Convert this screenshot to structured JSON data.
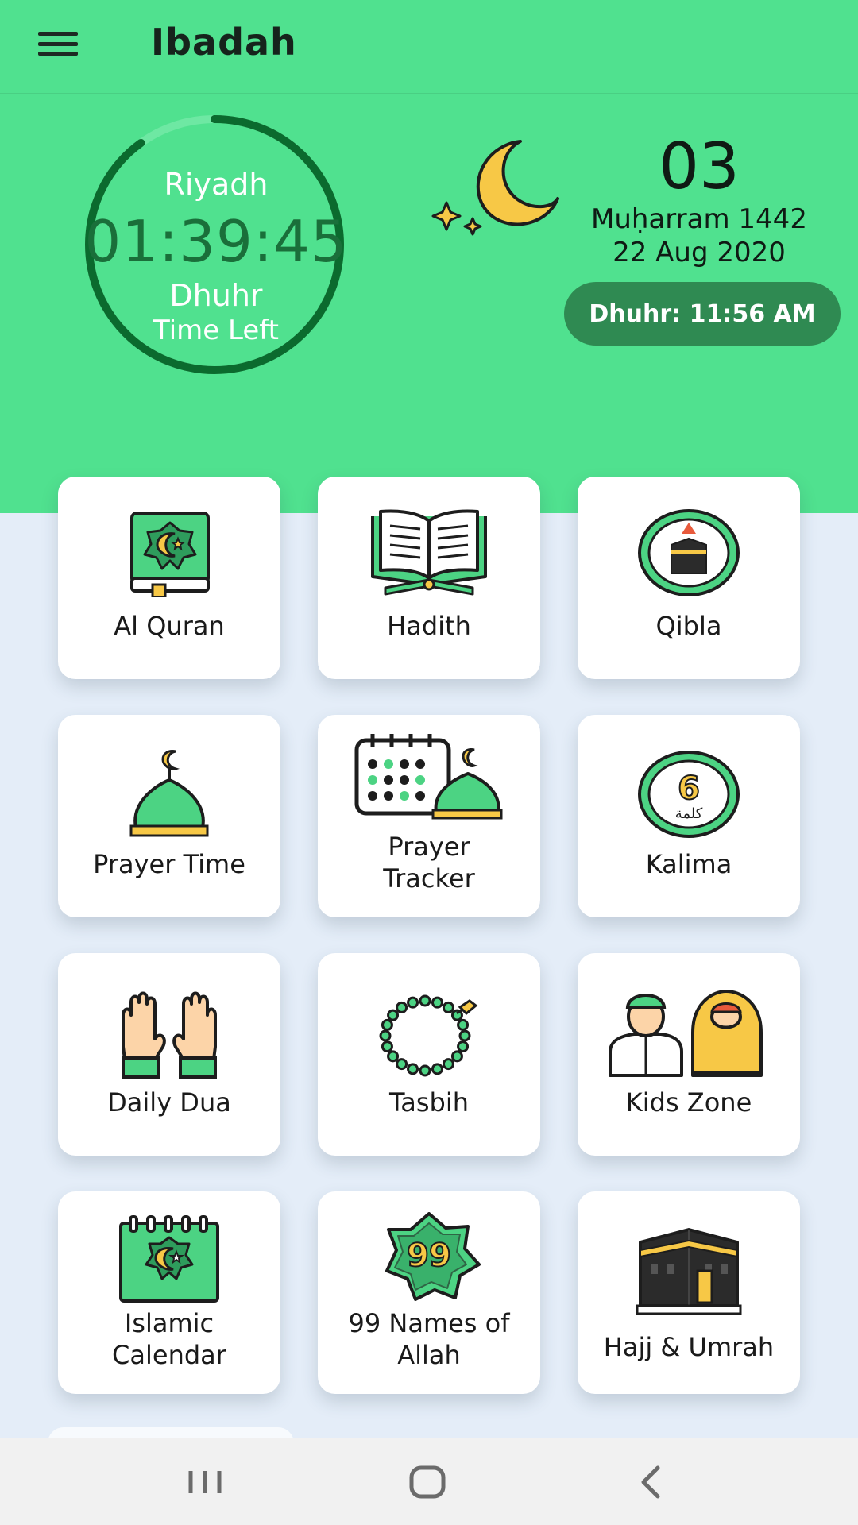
{
  "appbar": {
    "title": "Ibadah",
    "menu_icon": "hamburger-menu-icon"
  },
  "timer": {
    "city": "Riyadh",
    "time_left": "01:39:45",
    "prayer": "Dhuhr",
    "caption": "Time Left",
    "progress": 0.9
  },
  "date": {
    "day": "03",
    "hijri": "Muḥarram 1442",
    "gregorian": "22 Aug 2020"
  },
  "next_prayer": {
    "label": "Dhuhr: 11:56 AM"
  },
  "colors": {
    "header": "#50e18f",
    "accent_dark": "#0b6a2e",
    "pill": "#2f8a52",
    "background": "#e4edf8"
  },
  "tiles": [
    {
      "label": "Al Quran",
      "icon": "quran-book-icon"
    },
    {
      "label": "Hadith",
      "icon": "open-book-icon"
    },
    {
      "label": "Qibla",
      "icon": "qibla-compass-icon"
    },
    {
      "label": "Prayer Time",
      "icon": "mosque-dome-icon"
    },
    {
      "label": "Prayer Tracker",
      "icon": "calendar-mosque-icon"
    },
    {
      "label": "Kalima",
      "icon": "kalima-icon"
    },
    {
      "label": "Daily Dua",
      "icon": "praying-hands-icon"
    },
    {
      "label": "Tasbih",
      "icon": "prayer-beads-icon"
    },
    {
      "label": "Kids Zone",
      "icon": "kids-icon"
    },
    {
      "label": "Islamic Calendar",
      "icon": "islamic-calendar-icon"
    },
    {
      "label": "99 Names of Allah",
      "icon": "ninety-nine-names-icon"
    },
    {
      "label": "Hajj & Umrah",
      "icon": "kaaba-icon"
    }
  ],
  "kalima_badge": "6",
  "kalima_arabic": "كلمة",
  "names_badge": "99",
  "system_nav": {
    "recents": "recents-icon",
    "home": "home-icon",
    "back": "back-icon"
  }
}
